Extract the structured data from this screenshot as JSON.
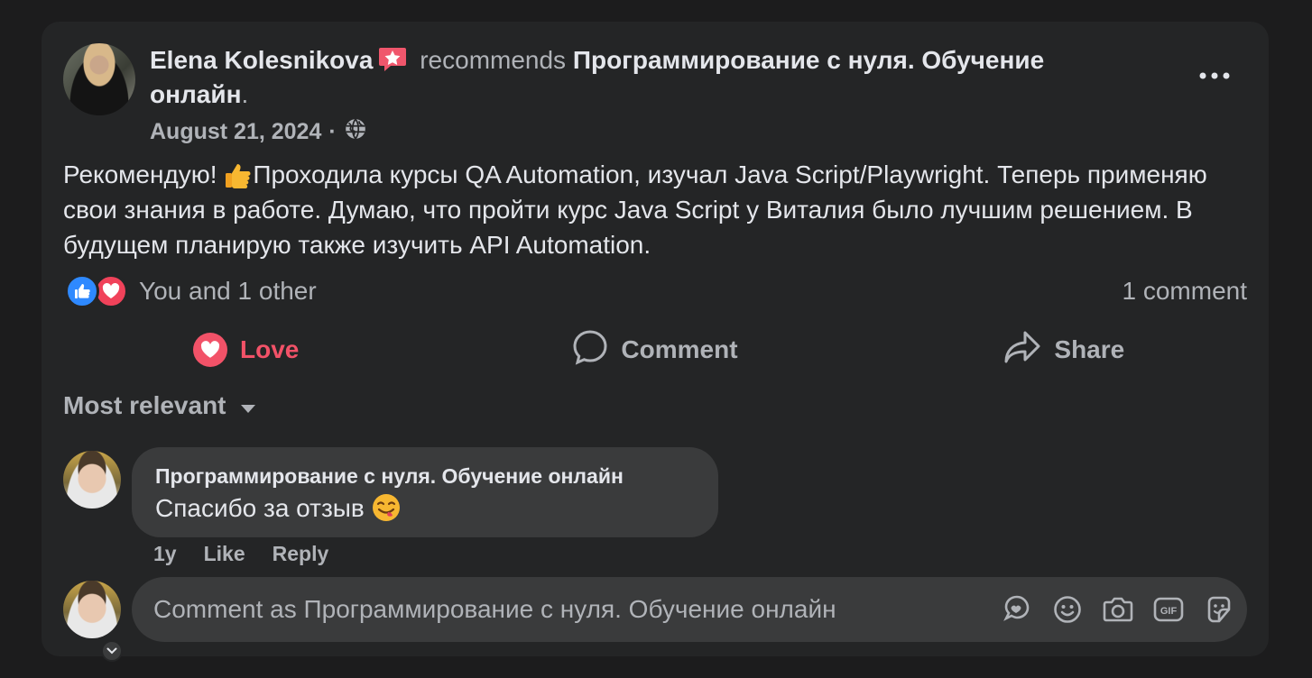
{
  "post": {
    "author": "Elena Kolesnikova",
    "verb": "recommends",
    "page_name": "Программирование с нуля. Обучение онлайн",
    "trailing_period": ".",
    "date": "August 21, 2024",
    "separator": "·",
    "audience_icon": "globe-icon",
    "text_part1": "Рекомендую! ",
    "text_part2": "Проходила курсы QA Automation, изучал Java Script/Playwright. Теперь применяю свои знания в работе. Думаю, что пройти курс Java Script у Виталия было лучшим решением. В будущем планирую также изучить API Automation.",
    "reactions_text": "You and 1 other",
    "comment_count": "1 comment"
  },
  "actions": {
    "love": "Love",
    "comment": "Comment",
    "share": "Share"
  },
  "comments": {
    "sort_label": "Most relevant",
    "items": [
      {
        "author": "Программирование с нуля. Обучение онлайн",
        "text": "Спасибо за отзыв ",
        "age": "1y",
        "like": "Like",
        "reply": "Reply"
      }
    ]
  },
  "composer": {
    "placeholder": "Comment as Программирование с нуля. Обучение онлайн"
  },
  "colors": {
    "background": "#1c1c1d",
    "card": "#242526",
    "bubble": "#3a3b3c",
    "love": "#f25268",
    "like": "#2e89ff",
    "muted_text": "#b0b3b8",
    "text": "#e4e6eb"
  }
}
